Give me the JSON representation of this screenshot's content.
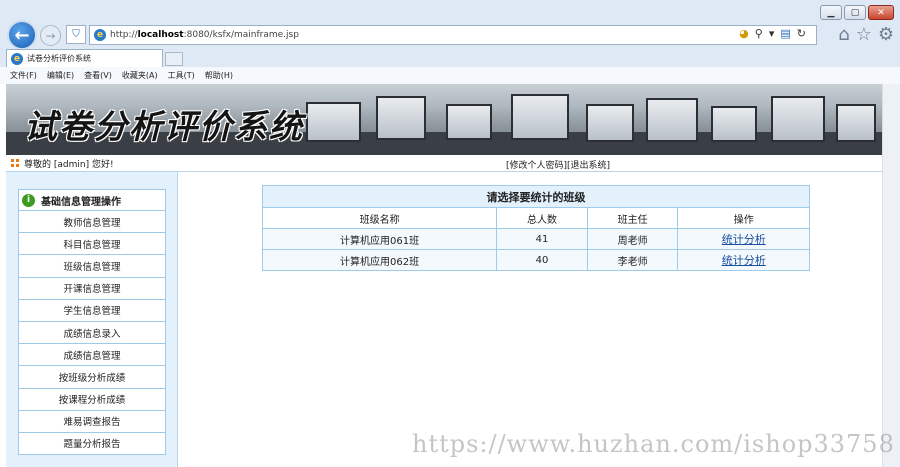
{
  "browser": {
    "url_prefix": "http://",
    "url_host": "localhost",
    "url_path": ":8080/ksfx/mainframe.jsp",
    "tab_title": "试卷分析评价系统",
    "menu": [
      "文件(F)",
      "编辑(E)",
      "查看(V)",
      "收藏夹(A)",
      "工具(T)",
      "帮助(H)"
    ]
  },
  "banner": {
    "title": "试卷分析评价系统"
  },
  "welcome": {
    "greeting": "尊敬的 [admin] 您好!",
    "change_password": "[修改个人密码]",
    "logout": "[退出系统]"
  },
  "sidebar": {
    "heading": "基础信息管理操作",
    "items": [
      "教师信息管理",
      "科目信息管理",
      "班级信息管理",
      "开课信息管理",
      "学生信息管理",
      "成绩信息录入",
      "成绩信息管理",
      "按班级分析成绩",
      "按课程分析成绩",
      "难易调查报告",
      "题量分析报告"
    ]
  },
  "main": {
    "table_title": "请选择要统计的班级",
    "columns": [
      "班级名称",
      "总人数",
      "班主任",
      "操作"
    ],
    "rows": [
      {
        "name": "计算机应用061班",
        "count": "41",
        "teacher": "周老师",
        "action": "统计分析"
      },
      {
        "name": "计算机应用062班",
        "count": "40",
        "teacher": "李老师",
        "action": "统计分析"
      }
    ]
  },
  "watermark": "https://www.huzhan.com/ishop33758"
}
